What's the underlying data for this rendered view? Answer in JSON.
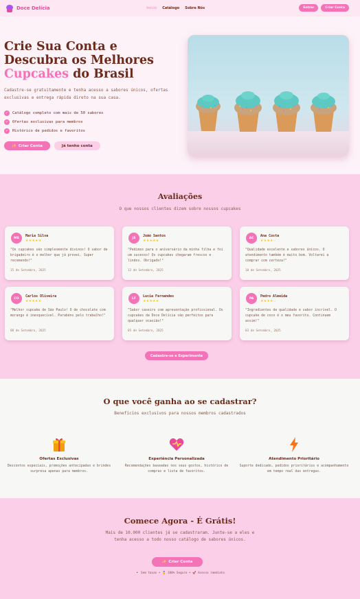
{
  "nav": {
    "brand": "Doce Delícia",
    "links": [
      {
        "label": "Início",
        "active": true
      },
      {
        "label": "Catálogo",
        "active": false
      },
      {
        "label": "Sobre Nós",
        "active": false
      }
    ],
    "login_label": "Entrar",
    "signup_label": "Criar Conta"
  },
  "hero": {
    "title_line1": "Crie Sua Conta e",
    "title_line2": "Descubra os Melhores",
    "title_highlight": "Cupcakes",
    "title_end": " do Brasil",
    "description": "Cadastre-se gratuitamente e tenha acesso a sabores únicos, ofertas exclusivas e entrega rápida direto na sua casa.",
    "features": [
      "Catálogo completo com mais de 50 sabores",
      "Ofertas exclusivas para membros",
      "Histórico de pedidos e favoritos"
    ],
    "check_glyph": "✓",
    "primary_icon": "✨",
    "primary_label": "Criar Conta",
    "secondary_label": "Já tenho conta",
    "image_icon": "cupcakes-photo"
  },
  "reviews": {
    "title": "Avaliações",
    "subtitle": "O que nossos clientes dizem sobre nossos cupcakes",
    "items": [
      {
        "initials": "MS",
        "name": "Maria Silva",
        "stars": "★★★★★",
        "stars_off": "",
        "text": "\"Os cupcakes são simplesmente divinos! O sabor de brigadeiro é o melhor que já provei. Super recomendo!\"",
        "date": "15 de Setembro, 2025"
      },
      {
        "initials": "JS",
        "name": "João Santos",
        "stars": "★★★★★",
        "stars_off": "",
        "text": "\"Pedimos para o aniversário da minha filha e foi um sucesso! Os cupcakes chegaram frescos e lindos. Obrigado!\"",
        "date": "12 de Setembro, 2025"
      },
      {
        "initials": "AC",
        "name": "Ana Costa",
        "stars": "★★★★",
        "stars_off": "☆",
        "text": "\"Qualidade excelente e sabores únicos. O atendimento também é muito bom. Voltarei a comprar com certeza!\"",
        "date": "10 de Setembro, 2025"
      },
      {
        "initials": "CO",
        "name": "Carlos Oliveira",
        "stars": "★★★★★",
        "stars_off": "",
        "text": "\"Melhor cupcake de São Paulo! O de chocolate com morango é inesquecível. Parabéns pelo trabalho!\"",
        "date": "08 de Setembro, 2025"
      },
      {
        "initials": "LF",
        "name": "Lucia Fernandes",
        "stars": "★★★★★",
        "stars_off": "",
        "text": "\"Sabor caseiro com apresentação profissional. Os cupcakes da Doce Delícia são perfeitos para qualquer ocasião!\"",
        "date": "05 de Setembro, 2025"
      },
      {
        "initials": "PA",
        "name": "Pedro Almeida",
        "stars": "★★★★",
        "stars_off": "☆",
        "text": "\"Ingredientes de qualidade e sabor incrível. O cupcake de coco é o meu favorito. Continuem assim!\"",
        "date": "03 de Setembro, 2025"
      }
    ],
    "button_label": "Cadastre-se e Experimente"
  },
  "benefits": {
    "title": "O que você ganha ao se cadastrar?",
    "subtitle": "Benefícios exclusivos para nossos membros cadastrados",
    "items": [
      {
        "icon": "gift-icon",
        "title": "Ofertas Exclusivas",
        "description": "Descontos especiais, promoções antecipadas e brindes surpresa apenas para membros."
      },
      {
        "icon": "heart-icon",
        "title": "Experiência Personalizada",
        "description": "Recomendações baseadas nos seus gostos, histórico de compras e lista de favoritos."
      },
      {
        "icon": "lightning-icon",
        "title": "Atendimento Prioritário",
        "description": "Suporte dedicado, pedidos prioritários e acompanhamento em tempo real das entregas."
      }
    ]
  },
  "cta": {
    "title": "Comece Agora - É Grátis!",
    "description": "Mais de 10.000 clientes já se cadastraram. Junte-se a eles e tenha acesso a todo nosso catálogo de sabores únicos.",
    "button_icon": "✨",
    "button_label": "Criar Conta",
    "badges": "💌 Sem taxas • 🏅 100% Seguro • 🚀 Acesso imediato"
  },
  "colors": {
    "accent": "#f472b6",
    "brown": "#6b2a1a",
    "pink_bg": "#fbcfe8"
  }
}
